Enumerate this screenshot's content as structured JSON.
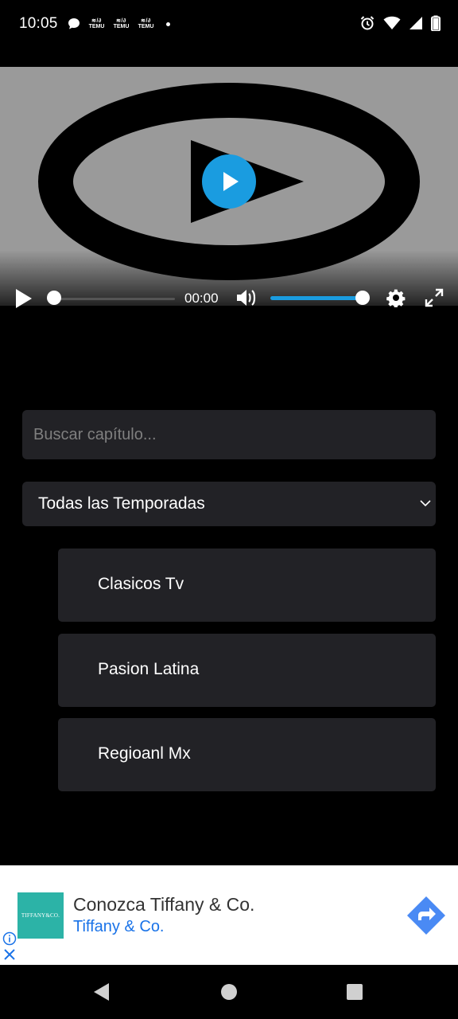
{
  "status_bar": {
    "time": "10:05",
    "notification_icons": [
      "chat-bubble-icon",
      "temu-icon",
      "temu-icon",
      "temu-icon",
      "dot-icon"
    ],
    "temu_label": "TEMU",
    "right_icons": [
      "alarm-icon",
      "wifi-icon",
      "signal-icon",
      "battery-icon"
    ]
  },
  "player": {
    "current_time": "00:00",
    "progress": 0,
    "volume": 1.0,
    "accent_color": "#1a9ce0"
  },
  "search": {
    "placeholder": "Buscar capítulo..."
  },
  "season_select": {
    "selected": "Todas las Temporadas"
  },
  "episodes": [
    {
      "label": "Clasicos Tv"
    },
    {
      "label": "Pasion Latina"
    },
    {
      "label": "Regioanl Mx"
    }
  ],
  "ad": {
    "logo_text": "TIFFANY&CO.",
    "title": "Conozca Tiffany & Co.",
    "subtitle": "Tiffany & Co.",
    "logo_color": "#2cb3a7",
    "link_color": "#1a73e8"
  }
}
